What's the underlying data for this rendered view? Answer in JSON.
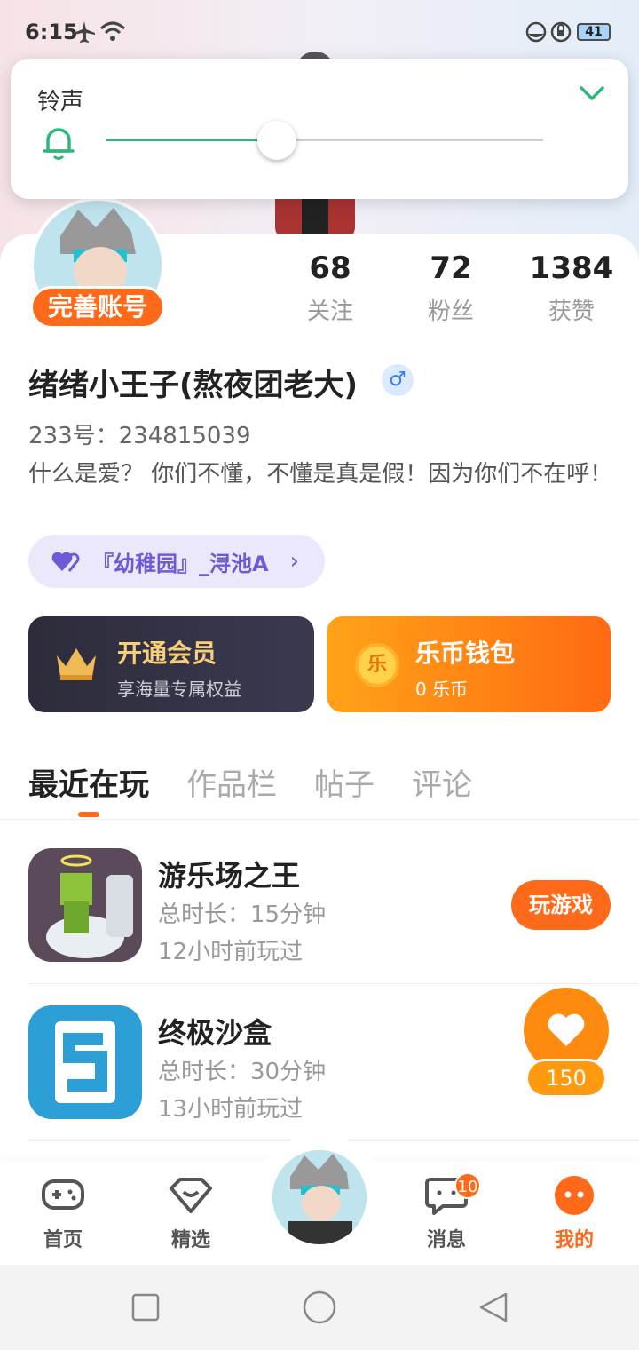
{
  "status_bar": {
    "time": "6:15",
    "battery": "41"
  },
  "volume_panel": {
    "title": "铃声",
    "level_percent": 39
  },
  "profile": {
    "complete_account": "完善账号",
    "stats": [
      {
        "value": "68",
        "label": "关注"
      },
      {
        "value": "72",
        "label": "粉丝"
      },
      {
        "value": "1384",
        "label": "获赞"
      }
    ],
    "username": "绪绪小王子(熬夜团老大)",
    "gender_symbol": "♂",
    "uid": "233号：234815039",
    "bio": "什么是爱？ 你们不懂，不懂是真是假！因为你们不在呼！",
    "group": "『幼稚园』_浔池A"
  },
  "vip": {
    "title": "开通会员",
    "subtitle": "享海量专属权益"
  },
  "wallet": {
    "title": "乐币钱包",
    "subtitle": "0 乐币",
    "coin_glyph": "乐"
  },
  "tabs": [
    {
      "label": "最近在玩",
      "active": true
    },
    {
      "label": "作品栏"
    },
    {
      "label": "帖子"
    },
    {
      "label": "评论"
    }
  ],
  "games": [
    {
      "name": "游乐场之王",
      "duration": "总时长：15分钟",
      "last_played": "12小时前玩过",
      "action": "玩游戏"
    },
    {
      "name": "终极沙盒",
      "duration": "总时长：30分钟",
      "last_played": "13小时前玩过"
    }
  ],
  "like_bubble": {
    "count": "150"
  },
  "bottom_nav": {
    "items": [
      {
        "label": "首页",
        "icon": "gamepad-icon"
      },
      {
        "label": "精选",
        "icon": "heart-badge-icon"
      },
      {
        "label": "消息",
        "icon": "chat-icon",
        "badge": "10"
      },
      {
        "label": "我的",
        "icon": "face-icon",
        "active": true
      }
    ]
  },
  "colors": {
    "accent": "#ff6a1a",
    "slider": "#2db87a",
    "vip_gold": "#f5cf7a",
    "group_purple": "#6d5ad6"
  }
}
